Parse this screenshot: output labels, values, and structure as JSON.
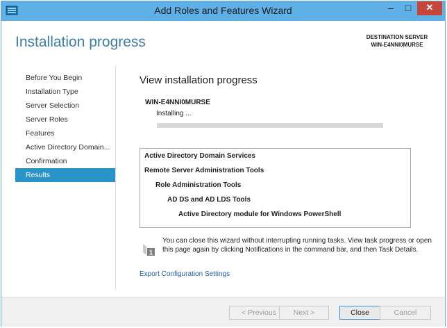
{
  "window": {
    "title": "Add Roles and Features Wizard",
    "controls": {
      "minimize": "–",
      "maximize": "□",
      "close": "✕"
    }
  },
  "header": {
    "page_title": "Installation progress",
    "destination_label": "DESTINATION SERVER",
    "destination_server": "WIN-E4NNI0MURSE"
  },
  "sidebar": {
    "items": [
      {
        "label": "Before You Begin",
        "active": false
      },
      {
        "label": "Installation Type",
        "active": false
      },
      {
        "label": "Server Selection",
        "active": false
      },
      {
        "label": "Server Roles",
        "active": false
      },
      {
        "label": "Features",
        "active": false
      },
      {
        "label": "Active Directory Domain...",
        "active": false
      },
      {
        "label": "Confirmation",
        "active": false
      },
      {
        "label": "Results",
        "active": true
      }
    ]
  },
  "main": {
    "section_title": "View installation progress",
    "server_name": "WIN-E4NNI0MURSE",
    "status": "Installing ...",
    "progress_fraction": 0,
    "features": [
      "Active Directory Domain Services",
      "Remote Server Administration Tools",
      "Role Administration Tools",
      "AD DS and AD LDS Tools",
      "Active Directory module for Windows PowerShell"
    ],
    "notice_badge": "1",
    "notice": "You can close this wizard without interrupting running tasks. View task progress or open this page again by clicking Notifications in the command bar, and then Task Details.",
    "export_link": "Export Configuration Settings"
  },
  "footer": {
    "previous": "< Previous",
    "next": "Next >",
    "close": "Close",
    "cancel": "Cancel"
  },
  "colors": {
    "titlebar": "#5fb0e6",
    "accent": "#3d7ea6",
    "active_nav": "#2a93c8",
    "close_button": "#c7463a",
    "link": "#1f5fa8"
  },
  "icons": {
    "app": "server-manager-icon",
    "notice": "notification-flag-icon"
  }
}
